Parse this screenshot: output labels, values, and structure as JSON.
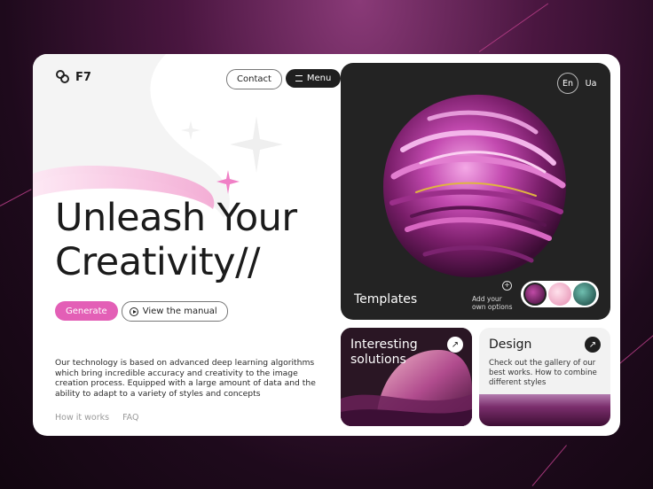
{
  "brand": {
    "name": "F7"
  },
  "nav": {
    "contact_label": "Contact",
    "menu_label": "Menu"
  },
  "hero": {
    "heading_line1": "Unleash Your",
    "heading_line2": "Creativity//",
    "generate_label": "Generate",
    "view_manual_label": "View the manual",
    "description": "Our technology is based on advanced deep learning algorithms which bring incredible accuracy and creativity to the image creation process. Equipped with a large amount of data and the ability to adapt to a variety of styles and concepts"
  },
  "footer": {
    "how_it_works": "How it works",
    "faq": "FAQ"
  },
  "language": {
    "active": "En",
    "other": "Ua"
  },
  "templates_panel": {
    "label": "Templates",
    "add_options_line1": "Add your",
    "add_options_line2": "own options",
    "swatch_colors": [
      "#5a1f52",
      "#f0b3c8",
      "#1f4a45"
    ]
  },
  "tiles": {
    "interesting": {
      "title_line1": "Interesting",
      "title_line2": "solutions"
    },
    "design": {
      "title": "Design",
      "text": "Check out the gallery of our best works. How to combine different styles"
    }
  },
  "colors": {
    "accent": "#e35fb6",
    "dark": "#232323",
    "bg": "#4a1640"
  }
}
